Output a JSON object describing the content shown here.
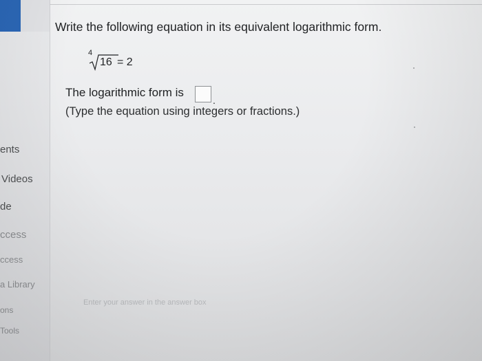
{
  "question": {
    "prompt": "Write the following equation in its equivalent logarithmic form.",
    "equation": {
      "root_index": "4",
      "radicand": "16",
      "rhs": " = 2"
    },
    "answer_label": "The logarithmic form is",
    "answer_value": "",
    "answer_suffix": ".",
    "hint": "(Type the equation using integers or fractions.)"
  },
  "footer": {
    "hint": "Enter your answer in the answer box"
  },
  "sidebar": {
    "items": [
      {
        "label": "ents"
      },
      {
        "label": "Videos"
      },
      {
        "label": "de"
      },
      {
        "label": "ccess"
      },
      {
        "label": "ccess"
      },
      {
        "label": "a Library"
      },
      {
        "label": "ons"
      },
      {
        "label": "Tools"
      }
    ]
  },
  "colors": {
    "accent": "#2b67b6",
    "text": "#1f2123",
    "background": "#e6e7ea"
  }
}
